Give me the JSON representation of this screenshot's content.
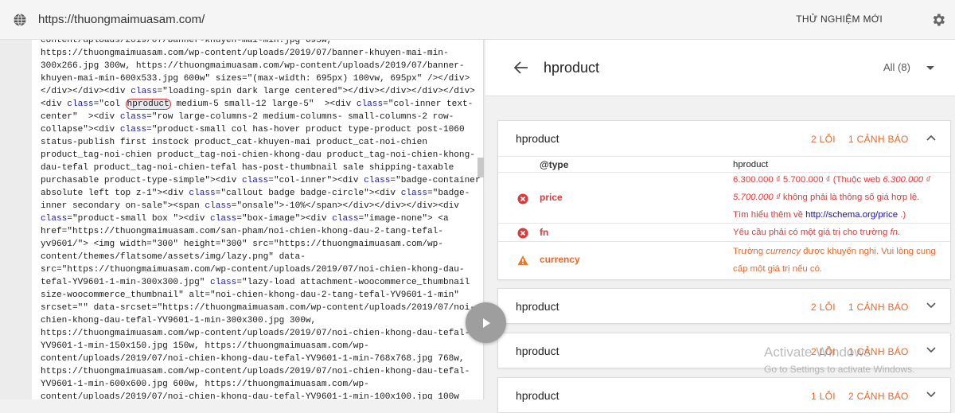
{
  "topbar": {
    "url": "https://thuongmaimuasam.com/",
    "test_label": "THỬ NGHIỆM MỚI"
  },
  "code": {
    "lines": [
      "content/uploads/2019/07/banner-khuyen-mai-min.jpg 695w,",
      "https://thuongmaimuasam.com/wp-content/uploads/2019/07/banner-khuyen-mai-min-",
      "300x266.jpg 300w, https://thuongmaimuasam.com/wp-content/uploads/2019/07/banner-",
      "khuyen-mai-min-600x533.jpg 600w\" sizes=\"(max-width: 695px) 100vw, 695px\" /></div>",
      "</div></div><div class=\"loading-spin dark large centered\"></div></div></div></div>",
      "<div class=\"col hproduct medium-5 small-12 large-5\"  ><div class=\"col-inner text-",
      "center\"  ><div class=\"row large-columns-2 medium-columns- small-columns-2 row-",
      "collapse\"><div class=\"product-small col has-hover product type-product post-1060",
      "status-publish first instock product_cat-khuyen-mai product_cat-noi-chien",
      "product_tag-noi-chien product_tag-noi-chien-khong-dau product_tag-noi-chien-khong-",
      "dau-tefal product_tag-noi-chien-tefal has-post-thumbnail sale shipping-taxable",
      "purchasable product-type-simple\"><div class=\"col-inner\"><div class=\"badge-container",
      "absolute left top z-1\"><div class=\"callout badge badge-circle\"><div class=\"badge-",
      "inner secondary on-sale\"><span class=\"onsale\">-10%</span></div></div></div><div",
      "class=\"product-small box \"><div class=\"box-image\"><div class=\"image-none\"> <a",
      "href=\"https://thuongmaimuasam.com/san-pham/noi-chien-khong-dau-2-tang-tefal-",
      "yv9601/\"> <img width=\"300\" height=\"300\" src=\"https://thuongmaimuasam.com/wp-",
      "content/themes/flatsome/assets/img/lazy.png\" data-",
      "src=\"https://thuongmaimuasam.com/wp-content/uploads/2019/07/noi-chien-khong-dau-",
      "tefal-YV9601-1-min-300x300.jpg\" class=\"lazy-load attachment-woocommerce_thumbnail",
      "size-woocommerce_thumbnail\" alt=\"noi-chien-khong-dau-2-tang-tefal-YV9601-1-min\"",
      "srcset=\"\" data-srcset=\"https://thuongmaimuasam.com/wp-content/uploads/2019/07/noi-",
      "chien-khong-dau-tefal-YV9601-1-min-300x300.jpg 300w,",
      "https://thuongmaimuasam.com/wp-content/uploads/2019/07/noi-chien-khong-dau-tefal-",
      "YV9601-1-min-150x150.jpg 150w, https://thuongmaimuasam.com/wp-",
      "content/uploads/2019/07/noi-chien-khong-dau-tefal-YV9601-1-min-768x768.jpg 768w,",
      "https://thuongmaimuasam.com/wp-content/uploads/2019/07/noi-chien-khong-dau-tefal-",
      "YV9601-1-min-600x600.jpg 600w, https://thuongmaimuasam.com/wp-",
      "content/uploads/2019/07/noi-chien-khong-dau-tefal-YV9601-1-min-100x100.jpg 100w"
    ],
    "highlight_word": "hproduct"
  },
  "panel": {
    "title": "hproduct",
    "filter": "All (8)"
  },
  "cards": [
    {
      "name": "hproduct",
      "errors": "2 LỖI",
      "warnings": "1 CẢNH BÁO",
      "expanded": true,
      "rows": {
        "type_key": "@type",
        "type_val": "hproduct",
        "price_key": "price",
        "price_msg_1": "6.300.000 ₫ 5.700.000 ₫ (Thuộc web ",
        "price_msg_em": "6.300.000 ₫ 5.700.000 ₫",
        "price_msg_2": " không phải là thông số giá hợp lệ. Tìm hiểu thêm về ",
        "price_link": "http://schema.org/price",
        "price_msg_3": " .)",
        "fn_key": "fn",
        "fn_msg_1": "Yêu cầu phải có một giá trị cho trường ",
        "fn_msg_em": "fn",
        "fn_msg_2": ".",
        "currency_key": "currency",
        "currency_msg_1": "Trường ",
        "currency_msg_em": "currency",
        "currency_msg_2": " được khuyến nghị. Vui lòng cung cấp một giá trị nếu có."
      }
    },
    {
      "name": "hproduct",
      "errors": "2 LỖI",
      "warnings": "1 CẢNH BÁO",
      "expanded": false
    },
    {
      "name": "hproduct",
      "errors": "2 LỖI",
      "warnings": "1 CẢNH BÁO",
      "expanded": false
    },
    {
      "name": "hproduct",
      "errors": "1 LỖI",
      "warnings": "2 CẢNH BÁO",
      "expanded": false
    }
  ],
  "watermark": {
    "line1": "Activate Windows",
    "line2": "Go to Settings to activate Windows."
  },
  "colors": {
    "error": "#d93b3b",
    "warning_text": "#e8692c",
    "warning_icon": "#e8792c"
  }
}
